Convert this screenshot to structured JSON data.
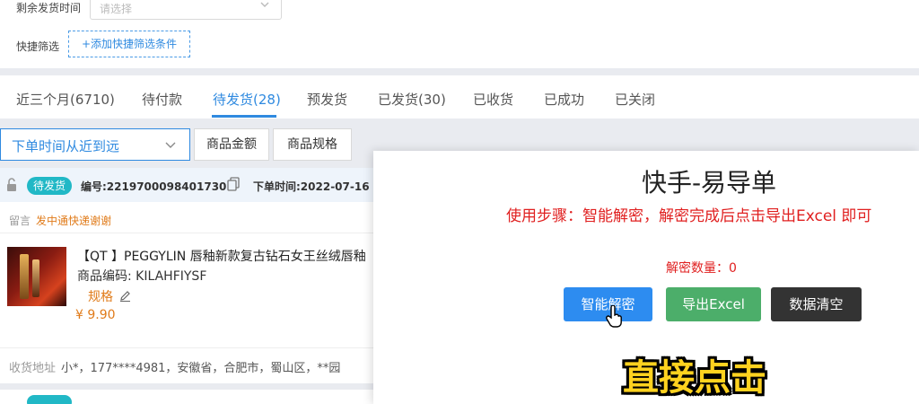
{
  "filters": {
    "ship_time_label": "剩余发货时间",
    "ship_time_placeholder": "请选择",
    "quick_filter_label": "快捷筛选",
    "add_quick_filter": "+添加快捷筛选条件"
  },
  "tabs": [
    {
      "label": "近三个月(6710)"
    },
    {
      "label": "待付款"
    },
    {
      "label": "待发货(28)"
    },
    {
      "label": "预发货"
    },
    {
      "label": "已发货(30)"
    },
    {
      "label": "已收货"
    },
    {
      "label": "已成功"
    },
    {
      "label": "已关闭"
    }
  ],
  "active_tab": "待发货(28)",
  "sort": {
    "selected": "下单时间从近到远",
    "buttons": [
      "商品金额",
      "商品规格"
    ]
  },
  "order": {
    "status": "待发货",
    "order_no": "编号:2219700098401730",
    "order_time": "下单时间:2022-07-16",
    "remark_label": "留言",
    "remark": "发中通快递谢谢",
    "product_title": "【QT 】PEGGYLIN 唇釉新款复古钻石女王丝绒唇釉",
    "product_code": "商品编码: KILAHFIYSF",
    "spec_label": "规格",
    "price": "¥ 9.90",
    "address_label": "收货地址",
    "address": "小*，177****4981，安徽省，合肥市，蜀山区，**园"
  },
  "modal": {
    "title": "快手-易导单",
    "steps": "使用步骤：智能解密，解密完成后点击导出Excel 即可",
    "decrypt_count": "解密数量：0",
    "buttons": {
      "decrypt": "智能解密",
      "export": "导出Excel",
      "clear": "数据清空"
    }
  },
  "overlay_caption": "直接点击",
  "colors": {
    "accent": "#2f8ae0",
    "badge": "#21b8c6",
    "warning": "#e07b1a",
    "danger": "#e02020",
    "export_green": "#4cae6a",
    "caption_yellow": "#ffd21f"
  }
}
